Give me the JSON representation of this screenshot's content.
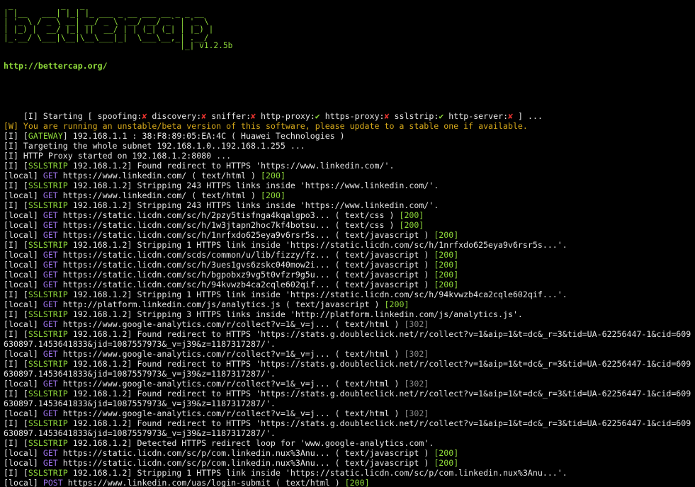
{
  "banner": {
    "art": " _          _   _\n| |__   ___| |_| |_ ___ _ __ ___ __ _ _ __\n| '_ \\ / _ \\ __| __/ _ \\ '__/ __/ _` | '_ \\\n| |_) |  __/ |_| ||  __/ | | (_| (_| | |_) |\n|_.__/ \\___|\\__|\\__\\___|_|  \\___\\__,_| .__/\n                                     |_| v1.2.5b",
    "url": "http://bettercap.org/"
  },
  "start": {
    "prefix": "[I] Starting [ ",
    "modules": [
      {
        "name": "spoofing:",
        "enabled": false
      },
      {
        "name": "discovery:",
        "enabled": false
      },
      {
        "name": "sniffer:",
        "enabled": false
      },
      {
        "name": "http-proxy:",
        "enabled": true
      },
      {
        "name": "https-proxy:",
        "enabled": false
      },
      {
        "name": "sslstrip:",
        "enabled": true
      },
      {
        "name": "http-server:",
        "enabled": false
      }
    ],
    "suffix": " ] ...",
    "check_glyph": "✔",
    "cross_glyph": "✘"
  },
  "colors": {
    "background": "#000000",
    "text": "#e6e6e6",
    "green": "#8fd93a",
    "gold": "#d6a91b",
    "violet": "#9c71e8",
    "gray": "#8a8a8a",
    "red": "#e8332f"
  },
  "log": [
    {
      "type": "warn",
      "text": "[W] You are running an unstable/beta version of this software, please update to a stable one if available."
    },
    {
      "type": "tagged",
      "prefix": "[I] [",
      "tag": "GATEWAY",
      "rest": "] 192.168.1.1 : 38:F8:89:05:EA:4C ( Huawei Technologies )"
    },
    {
      "type": "plain",
      "text": "[I] Targeting the whole subnet 192.168.1.0..192.168.1.255 ..."
    },
    {
      "type": "plain",
      "text": "[I] HTTP Proxy started on 192.168.1.2:8080 ..."
    },
    {
      "type": "tagged",
      "prefix": "[I] [",
      "tag": "SSLSTRIP",
      "rest": " 192.168.1.2] Found redirect to HTTPS 'https://www.linkedin.com/'."
    },
    {
      "type": "request",
      "method": "GET",
      "url": "https://www.linkedin.com/",
      "ctype": "text/html",
      "status": "200"
    },
    {
      "type": "tagged",
      "prefix": "[I] [",
      "tag": "SSLSTRIP",
      "rest": " 192.168.1.2] Stripping 243 HTTPS links inside 'https://www.linkedin.com/'."
    },
    {
      "type": "request",
      "method": "GET",
      "url": "https://www.linkedin.com/",
      "ctype": "text/html",
      "status": "200"
    },
    {
      "type": "tagged",
      "prefix": "[I] [",
      "tag": "SSLSTRIP",
      "rest": " 192.168.1.2] Stripping 243 HTTPS links inside 'https://www.linkedin.com/'."
    },
    {
      "type": "request",
      "method": "GET",
      "url": "https://static.licdn.com/sc/h/2pzy5tisfnga4kqalgpo3...",
      "ctype": "text/css",
      "status": "200"
    },
    {
      "type": "request",
      "method": "GET",
      "url": "https://static.licdn.com/sc/h/1w3jtapn2hoc7kf4botsu...",
      "ctype": "text/css",
      "status": "200"
    },
    {
      "type": "request",
      "method": "GET",
      "url": "https://static.licdn.com/sc/h/1nrfxdo625eya9v6rsr5s...",
      "ctype": "text/javascript",
      "status": "200"
    },
    {
      "type": "tagged",
      "prefix": "[I] [",
      "tag": "SSLSTRIP",
      "rest": " 192.168.1.2] Stripping 1 HTTPS link inside 'https://static.licdn.com/sc/h/1nrfxdo625eya9v6rsr5s...'."
    },
    {
      "type": "request",
      "method": "GET",
      "url": "https://static.licdn.com/scds/common/u/lib/fizzy/fz...",
      "ctype": "text/javascript",
      "status": "200"
    },
    {
      "type": "request",
      "method": "GET",
      "url": "https://static.licdn.com/sc/h/3ues1gvs6zskc040mow2i...",
      "ctype": "text/javascript",
      "status": "200"
    },
    {
      "type": "request",
      "method": "GET",
      "url": "https://static.licdn.com/sc/h/bgpobxz9vg5t0vfzr9g5u...",
      "ctype": "text/javascript",
      "status": "200"
    },
    {
      "type": "request",
      "method": "GET",
      "url": "https://static.licdn.com/sc/h/94kvwzb4ca2cqle602qif...",
      "ctype": "text/javascript",
      "status": "200"
    },
    {
      "type": "tagged",
      "prefix": "[I] [",
      "tag": "SSLSTRIP",
      "rest": " 192.168.1.2] Stripping 1 HTTPS link inside 'https://static.licdn.com/sc/h/94kvwzb4ca2cqle602qif...'."
    },
    {
      "type": "request",
      "method": "GET",
      "url": "http://platform.linkedin.com/js/analytics.js",
      "ctype": "text/javascript",
      "status": "200"
    },
    {
      "type": "tagged",
      "prefix": "[I] [",
      "tag": "SSLSTRIP",
      "rest": " 192.168.1.2] Stripping 3 HTTPS links inside 'http://platform.linkedin.com/js/analytics.js'."
    },
    {
      "type": "request",
      "method": "GET",
      "url": "https://www.google-analytics.com/r/collect?v=1&_v=j...",
      "ctype": "text/html",
      "status": "302"
    },
    {
      "type": "tagged",
      "prefix": "[I] [",
      "tag": "SSLSTRIP",
      "rest": " 192.168.1.2] Found redirect to HTTPS 'https://stats.g.doubleclick.net/r/collect?v=1&aip=1&t=dc&_r=3&tid=UA-62256447-1&cid=609630897.1453641833&jid=1087557973&_v=j39&z=1187317287/'."
    },
    {
      "type": "request",
      "method": "GET",
      "url": "https://www.google-analytics.com/r/collect?v=1&_v=j...",
      "ctype": "text/html",
      "status": "302"
    },
    {
      "type": "tagged",
      "prefix": "[I] [",
      "tag": "SSLSTRIP",
      "rest": " 192.168.1.2] Found redirect to HTTPS 'https://stats.g.doubleclick.net/r/collect?v=1&aip=1&t=dc&_r=3&tid=UA-62256447-1&cid=609630897.1453641833&jid=1087557973&_v=j39&z=1187317287/'."
    },
    {
      "type": "request",
      "method": "GET",
      "url": "https://www.google-analytics.com/r/collect?v=1&_v=j...",
      "ctype": "text/html",
      "status": "302"
    },
    {
      "type": "tagged",
      "prefix": "[I] [",
      "tag": "SSLSTRIP",
      "rest": " 192.168.1.2] Found redirect to HTTPS 'https://stats.g.doubleclick.net/r/collect?v=1&aip=1&t=dc&_r=3&tid=UA-62256447-1&cid=609630897.1453641833&jid=1087557973&_v=j39&z=1187317287/'."
    },
    {
      "type": "request",
      "method": "GET",
      "url": "https://www.google-analytics.com/r/collect?v=1&_v=j...",
      "ctype": "text/html",
      "status": "302"
    },
    {
      "type": "tagged",
      "prefix": "[I] [",
      "tag": "SSLSTRIP",
      "rest": " 192.168.1.2] Found redirect to HTTPS 'https://stats.g.doubleclick.net/r/collect?v=1&aip=1&t=dc&_r=3&tid=UA-62256447-1&cid=609630897.1453641833&jid=1087557973&_v=j39&z=1187317287/'."
    },
    {
      "type": "tagged",
      "prefix": "[I] [",
      "tag": "SSLSTRIP",
      "rest": " 192.168.1.2] Detected HTTPS redirect loop for 'www.google-analytics.com'."
    },
    {
      "type": "request",
      "method": "GET",
      "url": "https://static.licdn.com/sc/p/com.linkedin.nux%3Anu...",
      "ctype": "text/javascript",
      "status": "200"
    },
    {
      "type": "request",
      "method": "GET",
      "url": "https://static.licdn.com/sc/p/com.linkedin.nux%3Anu...",
      "ctype": "text/javascript",
      "status": "200"
    },
    {
      "type": "tagged",
      "prefix": "[I] [",
      "tag": "SSLSTRIP",
      "rest": " 192.168.1.2] Stripping 1 HTTPS link inside 'https://static.licdn.com/sc/p/com.linkedin.nux%3Anu...'."
    },
    {
      "type": "request",
      "method": "POST",
      "url": "https://www.linkedin.com/uas/login-submit",
      "ctype": "text/html",
      "status": "200"
    }
  ]
}
